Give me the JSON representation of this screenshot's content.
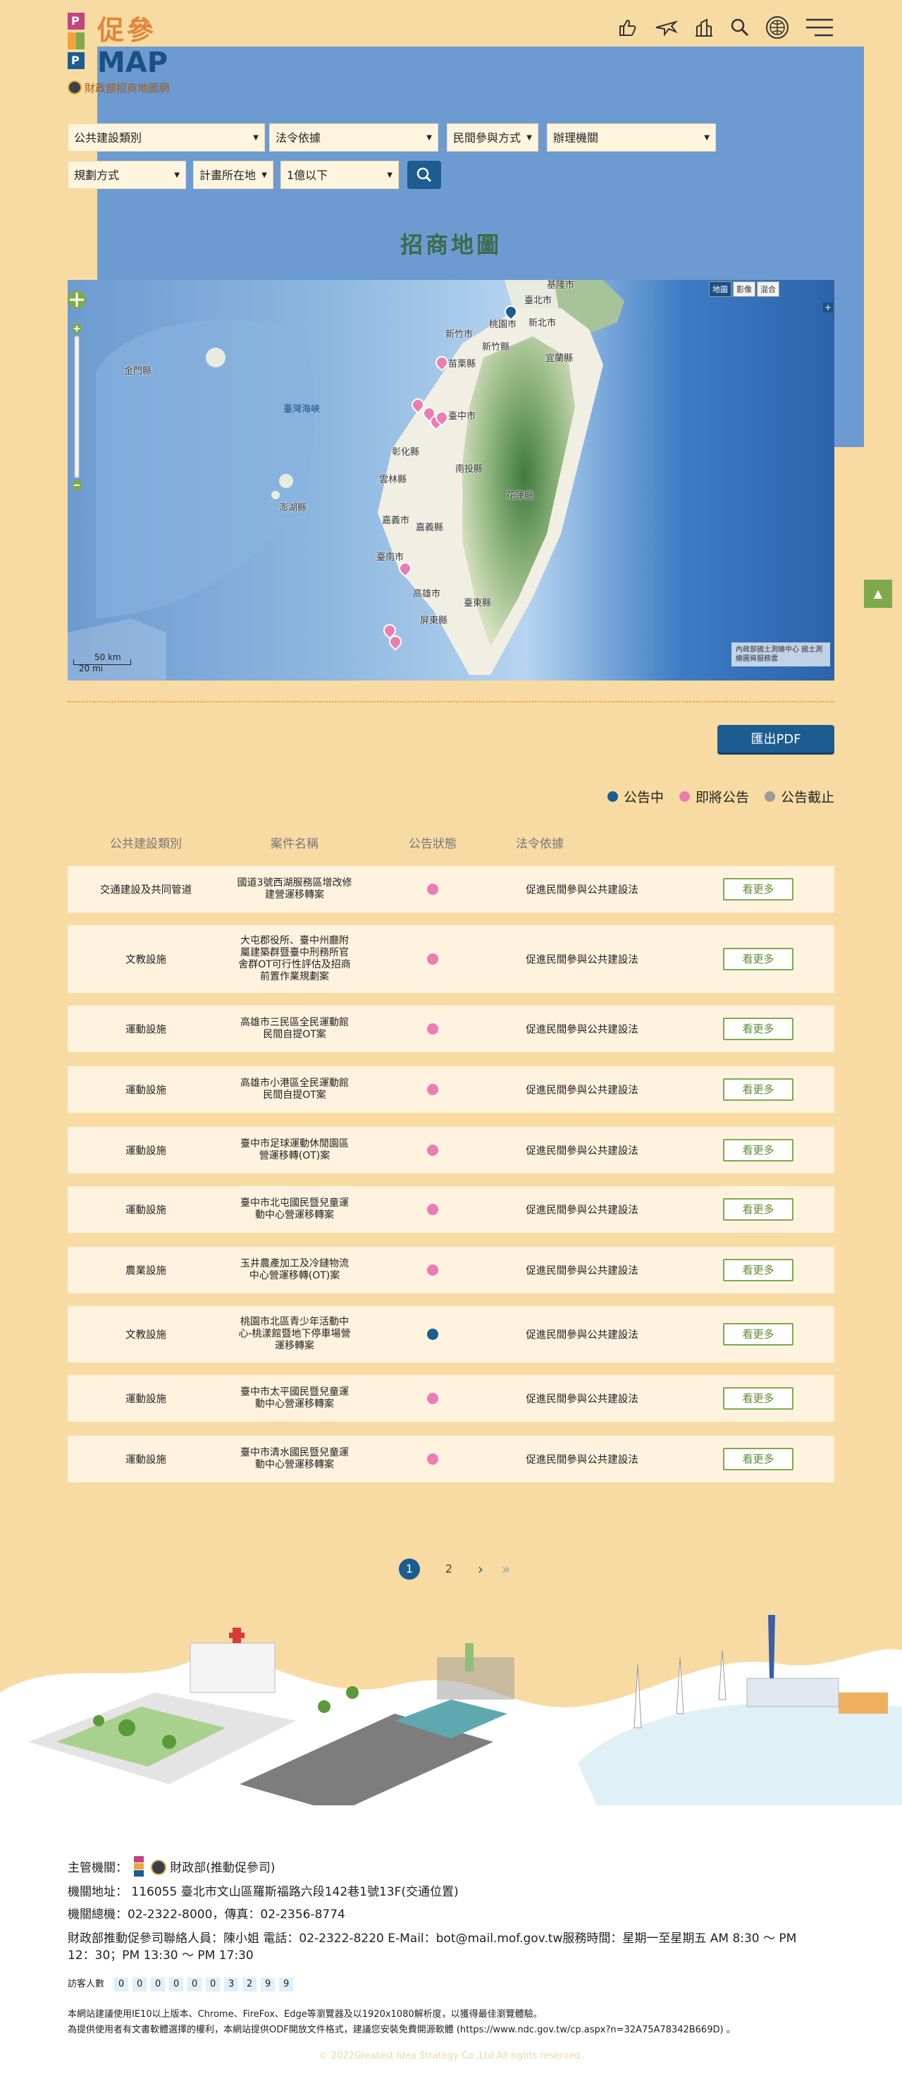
{
  "header": {
    "logo_cn": "促參",
    "logo_en": "MAP",
    "logo_sub": "財政部招商地圖網",
    "icons": [
      "thumbs-up-icon",
      "plane-icon",
      "city-icon",
      "search-icon",
      "globe-icon",
      "menu-icon"
    ]
  },
  "filters": {
    "category": "公共建設類別",
    "law": "法令依據",
    "method": "民間參與方式",
    "agency": "辦理機關",
    "plan": "規劃方式",
    "location": "計畫所在地",
    "amount": "1億以下"
  },
  "section_title": "招商地圖",
  "map": {
    "types": [
      "地圖",
      "影像",
      "混合"
    ],
    "labels": {
      "taipei": "臺北市",
      "new_taipei": "新北市",
      "keelung": "基隆市",
      "taoyuan": "桃園市",
      "hsinchu_city": "新竹市",
      "hsinchu": "新竹縣",
      "yilan": "宜蘭縣",
      "miaoli": "苗栗縣",
      "taichung": "臺中市",
      "changhua": "彰化縣",
      "nantou": "南投縣",
      "yunlin": "雲林縣",
      "hualien": "花蓮縣",
      "chiayi_city": "嘉義市",
      "chiayi": "嘉義縣",
      "tainan": "臺南市",
      "kaohsiung": "高雄市",
      "taitung": "臺東縣",
      "pingtung": "屏東縣",
      "penghu": "澎湖縣",
      "kinmen": "金門縣",
      "strait": "臺灣海峽"
    },
    "scale_km": "50 km",
    "scale_mi": "20 mi",
    "copyright": "內政部國土測繪中心 國土測繪圖資服務雲"
  },
  "pdf_button": "匯出PDF",
  "legend": [
    {
      "label": "公告中",
      "color": "#1c5c90"
    },
    {
      "label": "即將公告",
      "color": "#ec7cb1"
    },
    {
      "label": "公告截止",
      "color": "#9a9a9a"
    }
  ],
  "table": {
    "headers": [
      "公共建設類別",
      "案件名稱",
      "公告狀態",
      "法令依據"
    ],
    "more_label": "看更多",
    "rows": [
      {
        "category": "交通建設及共同管道",
        "name": "國道3號西湖服務區增改修建營運移轉案",
        "status": "#ec7cb1",
        "law": "促進民間參與公共建設法"
      },
      {
        "category": "文教設施",
        "name": "大屯郡役所、臺中州廳附屬建築群暨臺中刑務所官舍群OT可行性評估及招商前置作業規劃案",
        "status": "#ec7cb1",
        "law": "促進民間參與公共建設法"
      },
      {
        "category": "運動設施",
        "name": "高雄市三民區全民運動館民間自提OT案",
        "status": "#ec7cb1",
        "law": "促進民間參與公共建設法"
      },
      {
        "category": "運動設施",
        "name": "高雄市小港區全民運動館民間自提OT案",
        "status": "#ec7cb1",
        "law": "促進民間參與公共建設法"
      },
      {
        "category": "運動設施",
        "name": "臺中市足球運動休閒園區營運移轉(OT)案",
        "status": "#ec7cb1",
        "law": "促進民間參與公共建設法"
      },
      {
        "category": "運動設施",
        "name": "臺中市北屯國民暨兒童運動中心營運移轉案",
        "status": "#ec7cb1",
        "law": "促進民間參與公共建設法"
      },
      {
        "category": "農業設施",
        "name": "玉井農產加工及冷鏈物流中心營運移轉(OT)案",
        "status": "#ec7cb1",
        "law": "促進民間參與公共建設法"
      },
      {
        "category": "文教設施",
        "name": "桃園市北區青少年活動中心-桃漾館暨地下停車場營運移轉案",
        "status": "#1c5c90",
        "law": "促進民間參與公共建設法"
      },
      {
        "category": "運動設施",
        "name": "臺中市太平國民暨兒童運動中心營運移轉案",
        "status": "#ec7cb1",
        "law": "促進民間參與公共建設法"
      },
      {
        "category": "運動設施",
        "name": "臺中市清水國民暨兒童運動中心營運移轉案",
        "status": "#ec7cb1",
        "law": "促進民間參與公共建設法"
      }
    ]
  },
  "pagination": {
    "pages": [
      "1",
      "2"
    ],
    "next": "›",
    "last": "»"
  },
  "footer": {
    "authority_label": "主管機關：",
    "authority": "財政部(推動促參司)",
    "address": "機關地址： 116055 臺北市文山區羅斯福路六段142巷1號13F(交通位置)",
    "phone": "機關總機：02-2322-8000，傳真：02-2356-8774",
    "contact1": "財政部推動促參司聯絡人員：陳小姐 電話：02-2322-8220 E-Mail：bot@mail.mof.gov.tw服務時間：星期一至星期五 AM 8:30 ～ PM",
    "contact2": "12：30；PM 13:30 ～ PM 17:30",
    "visitor_label": "訪客人數",
    "visitor_digits": [
      "0",
      "0",
      "0",
      "0",
      "0",
      "0",
      "3",
      "2",
      "9",
      "9"
    ],
    "note1": "本網站建議使用IE10以上版本、Chrome、FireFox、Edge等瀏覽器及以1920x1080解析度，以獲得最佳瀏覽體驗。",
    "note2": "為提供使用者有文書軟體選擇的權利，本網站提供ODF開放文件格式，建議您安裝免費開源軟體 (https://www.ndc.gov.tw/cp.aspx?n=32A75A78342B669D) 。",
    "copyright": "© 2022Greatest Idea Strategy Co.,Ltd All rights reserved."
  }
}
